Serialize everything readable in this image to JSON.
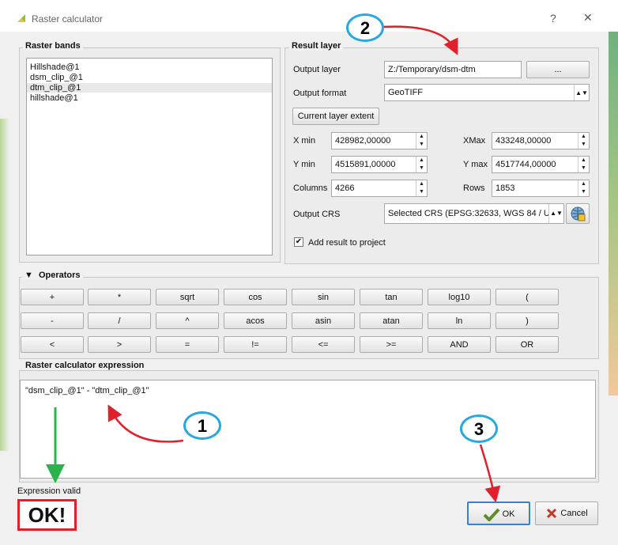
{
  "window": {
    "title": "Raster calculator",
    "help": "?",
    "close": "✕"
  },
  "raster_bands": {
    "title": "Raster bands",
    "items": [
      "Hillshade@1",
      "dsm_clip_@1",
      "dtm_clip_@1",
      "hillshade@1"
    ]
  },
  "result_layer": {
    "title": "Result layer",
    "output_layer_label": "Output layer",
    "output_layer_value": "Z:/Temporary/dsm-dtm",
    "browse_label": "...",
    "output_format_label": "Output format",
    "output_format_value": "GeoTIFF",
    "extent_button": "Current layer extent",
    "xmin_label": "X min",
    "xmin_value": "428982,00000",
    "xmax_label": "XMax",
    "xmax_value": "433248,00000",
    "ymin_label": "Y min",
    "ymin_value": "4515891,00000",
    "ymax_label": "Y max",
    "ymax_value": "4517744,00000",
    "columns_label": "Columns",
    "columns_value": "4266",
    "rows_label": "Rows",
    "rows_value": "1853",
    "crs_label": "Output CRS",
    "crs_value": "Selected CRS (EPSG:32633, WGS 84 / UTM",
    "add_result_label": "Add result to project"
  },
  "operators": {
    "title": "Operators",
    "row1": [
      "+",
      "*",
      "sqrt",
      "cos",
      "sin",
      "tan",
      "log10",
      "("
    ],
    "row2": [
      "-",
      "/",
      "^",
      "acos",
      "asin",
      "atan",
      "ln",
      ")"
    ],
    "row3": [
      "<",
      ">",
      "=",
      "!=",
      "<=",
      ">=",
      "AND",
      "OR"
    ]
  },
  "expression": {
    "title": "Raster calculator expression",
    "value": "\"dsm_clip_@1\" - \"dtm_clip_@1\"",
    "status": "Expression valid"
  },
  "buttons": {
    "ok": "OK",
    "cancel": "Cancel"
  },
  "annotations": {
    "callout1": "1",
    "callout2": "2",
    "callout3": "3",
    "ok_badge": "OK!"
  },
  "colors": {
    "callout_border": "#29a7e0",
    "red_arrow": "#e0202a",
    "green_arrow": "#2cb34a"
  }
}
